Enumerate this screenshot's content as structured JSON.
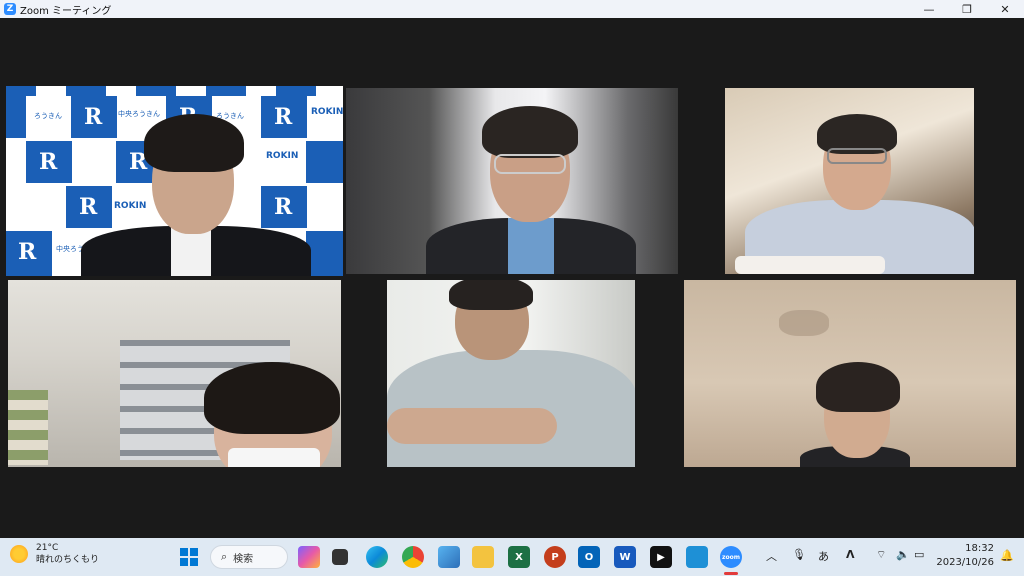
{
  "window": {
    "title": "Zoom ミーティング",
    "logo_letter": "Z",
    "minimize": "—",
    "restore": "❐",
    "close": "✕"
  },
  "participants": [
    {
      "id": "p1",
      "active": true,
      "backdrop": "logo-wall",
      "banner_text": [
        "ROKIN",
        "中央ろうきん",
        "ろうきん"
      ]
    },
    {
      "id": "p2",
      "active": false,
      "backdrop": "office"
    },
    {
      "id": "p3",
      "active": false,
      "backdrop": "room"
    },
    {
      "id": "p4",
      "active": false,
      "backdrop": "shop-shelves"
    },
    {
      "id": "p5",
      "active": false,
      "backdrop": "room"
    },
    {
      "id": "p6",
      "active": false,
      "backdrop": "wall"
    }
  ],
  "taskbar": {
    "weather_temp": "21°C",
    "weather_desc": "晴れのちくもり",
    "search_placeholder": "検索",
    "clock_time": "18:32",
    "clock_date": "2023/10/26",
    "ime_indicator": "あ",
    "pinned_apps": [
      "windows-start",
      "search",
      "copilot",
      "task-view",
      "edge",
      "chrome",
      "photos",
      "file-explorer",
      "excel",
      "powerpoint",
      "outlook",
      "word",
      "media-player",
      "store",
      "zoom"
    ],
    "colors": {
      "excel": "#1d7044",
      "powerpoint": "#c43e1c",
      "outlook": "#0364b8",
      "word": "#185abd",
      "zoom": "#2d8cff",
      "edge": "#0c8ad8",
      "chrome": "#ea4335"
    }
  }
}
